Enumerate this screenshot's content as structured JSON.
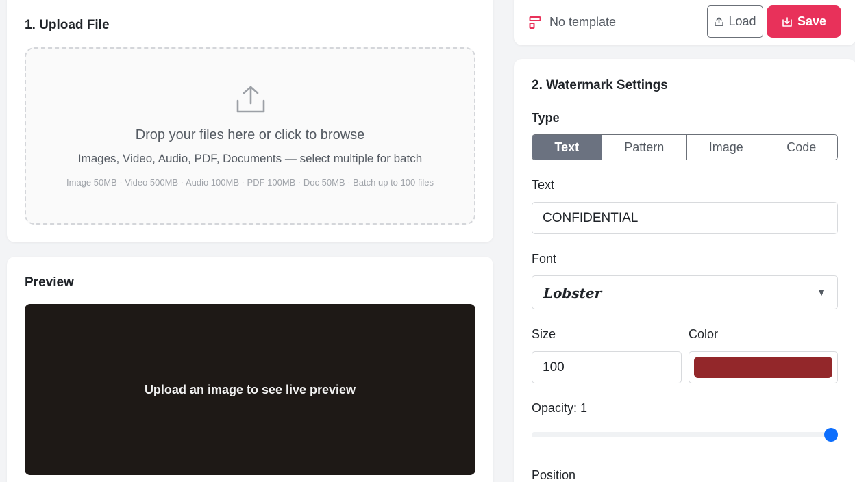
{
  "upload": {
    "title": "1. Upload File",
    "dropzone": {
      "main_text": "Drop your files here or click to browse",
      "sub_text": "Images, Video, Audio, PDF, Documents — select multiple for batch",
      "limits_text": "Image 50MB · Video 500MB · Audio 100MB · PDF 100MB · Doc 50MB · Batch up to 100 files",
      "icon": "upload-icon"
    }
  },
  "preview": {
    "title": "Preview",
    "placeholder": "Upload an image to see live preview"
  },
  "template": {
    "label": "No template",
    "icon": "template-icon",
    "load_label": "Load",
    "save_label": "Save"
  },
  "settings": {
    "title": "2. Watermark Settings",
    "type_label": "Type",
    "types": [
      "Text",
      "Pattern",
      "Image",
      "Code"
    ],
    "active_type": "Text",
    "text_label": "Text",
    "text_value": "CONFIDENTIAL",
    "font_label": "Font",
    "font_value": "Lobster",
    "size_label": "Size",
    "size_value": "100",
    "color_label": "Color",
    "color_value": "#93272a",
    "opacity_label": "Opacity: 1",
    "opacity_value": 1,
    "position_label": "Position"
  },
  "colors": {
    "accent": "#e8315a",
    "active_type_bg": "#6b7280",
    "slider_thumb": "#0d6efd",
    "preview_bg": "#1e1916"
  }
}
